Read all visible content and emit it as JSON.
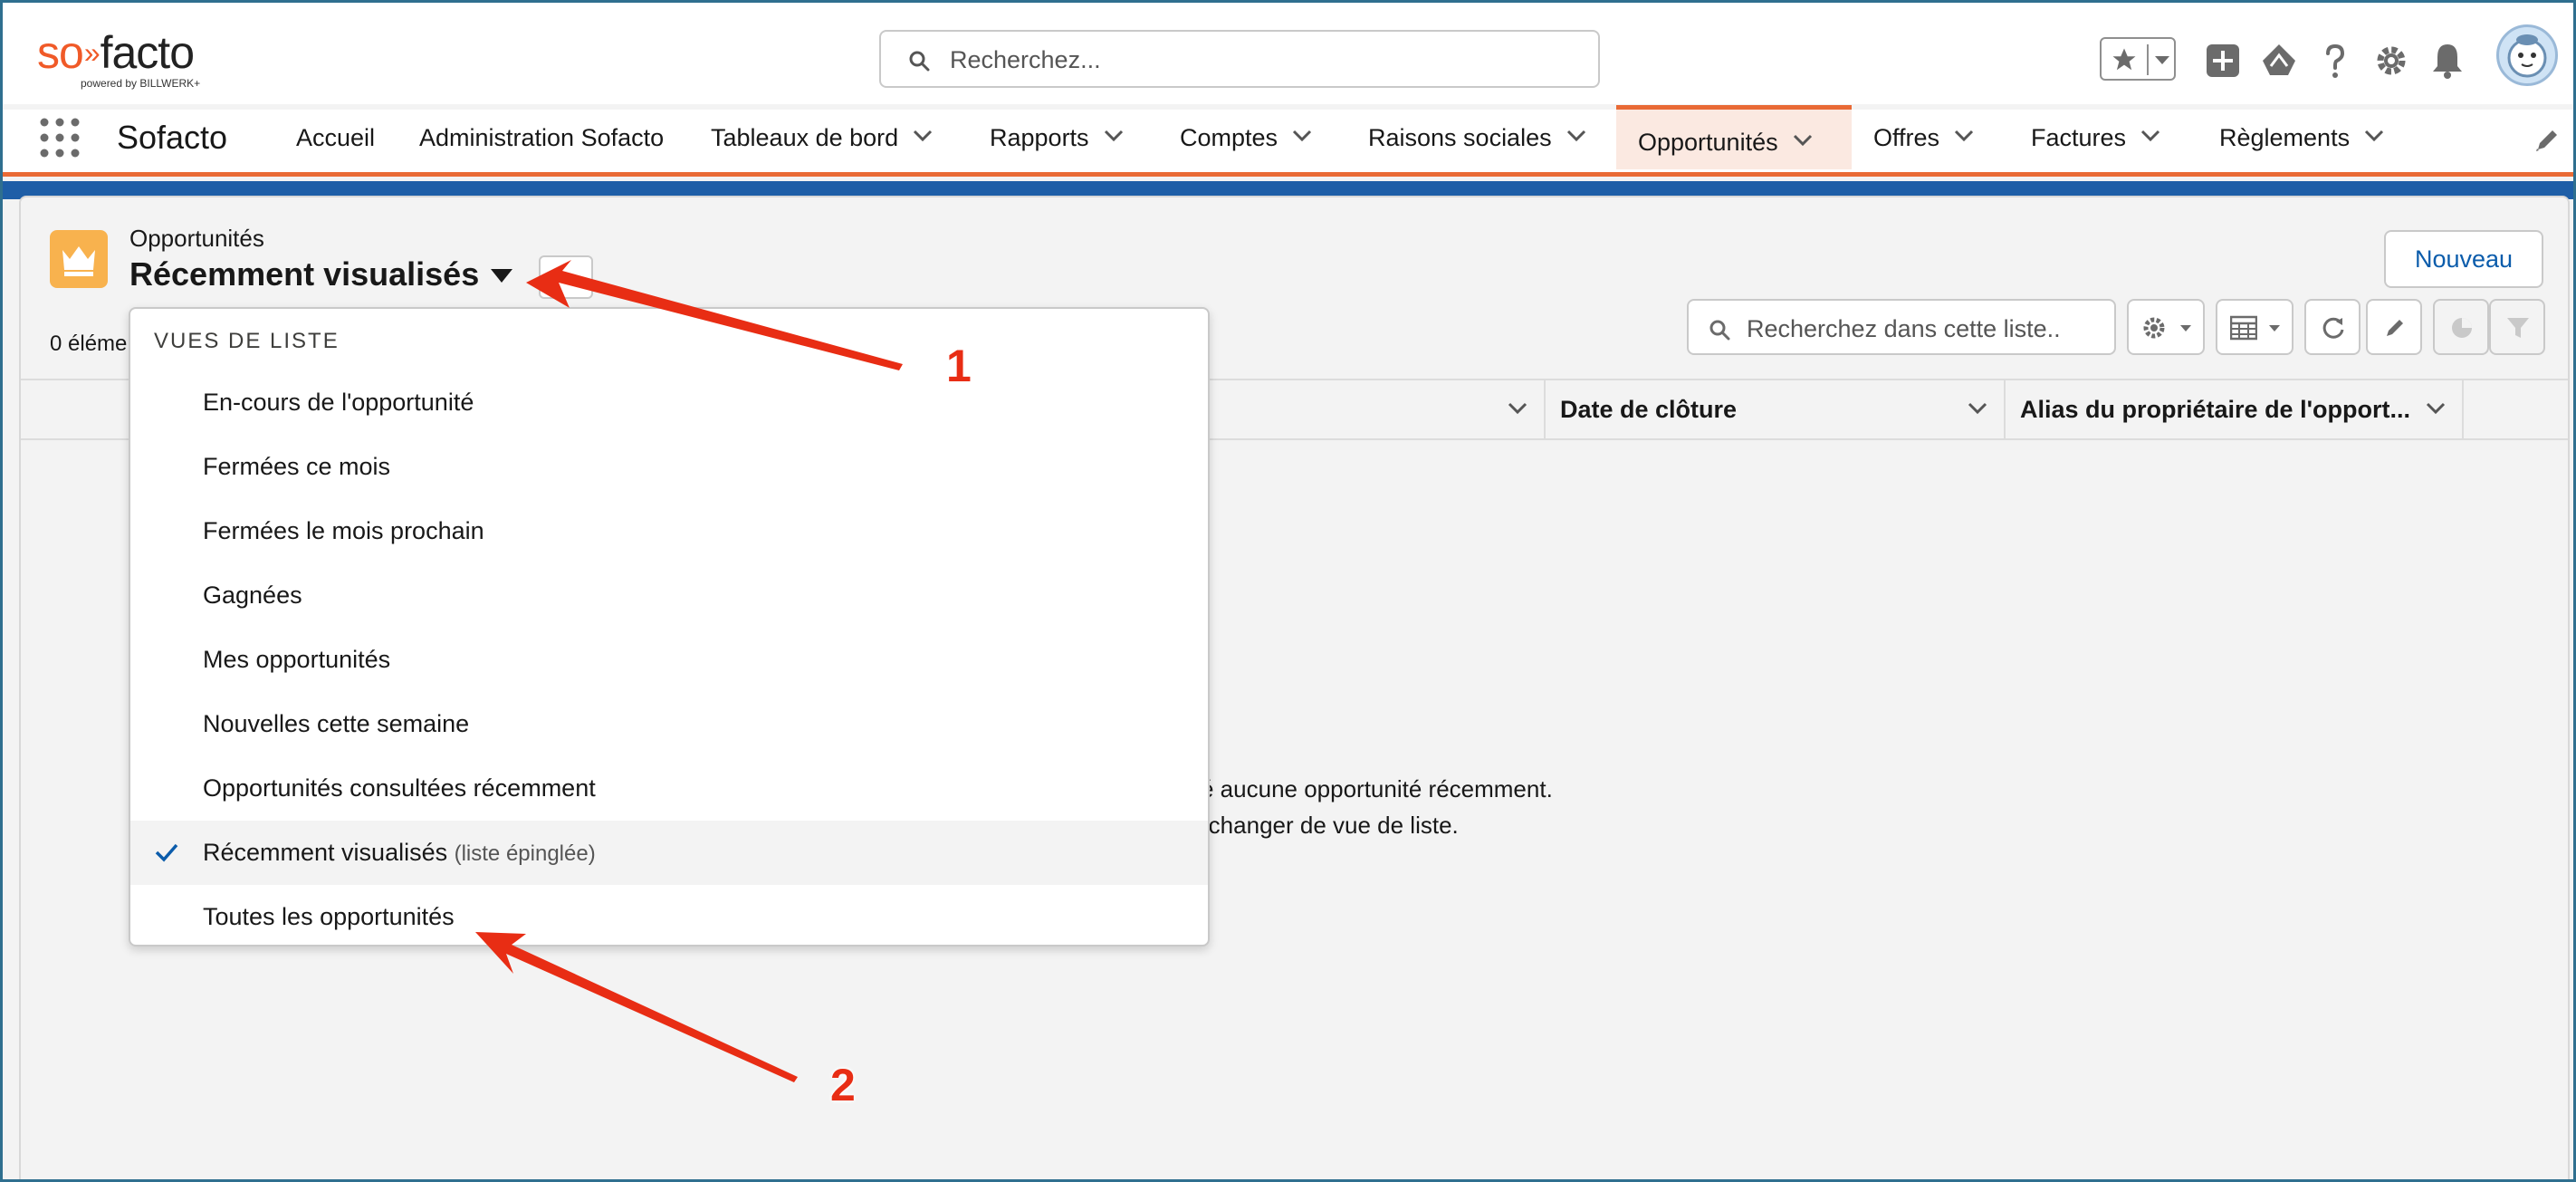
{
  "header": {
    "logo_text": "so»facto",
    "logo_tagline": "powered by BILLWERK+",
    "search_placeholder": "Recherchez..."
  },
  "nav": {
    "app_name": "Sofacto",
    "items": [
      {
        "label": "Accueil"
      },
      {
        "label": "Administration Sofacto"
      },
      {
        "label": "Tableaux de bord"
      },
      {
        "label": "Rapports"
      },
      {
        "label": "Comptes"
      },
      {
        "label": "Raisons sociales"
      },
      {
        "label": "Opportunités"
      },
      {
        "label": "Offres"
      },
      {
        "label": "Factures"
      },
      {
        "label": "Règlements"
      }
    ],
    "active": "Opportunités"
  },
  "list": {
    "object_label": "Opportunités",
    "view_title": "Récemment visualisés",
    "count_text": "0 éléme",
    "new_button": "Nouveau",
    "search_placeholder": "Recherchez dans cette liste..",
    "columns": [
      {
        "label": ""
      },
      {
        "label": "Date de clôture"
      },
      {
        "label": "Alias du propriétaire de l'opport..."
      }
    ],
    "empty_line_1": "sé aucune opportunité récemment.",
    "empty_line_2": "e changer de vue de liste."
  },
  "dropdown": {
    "header": "VUES DE LISTE",
    "items": [
      {
        "label": "En-cours de l'opportunité"
      },
      {
        "label": "Fermées ce mois"
      },
      {
        "label": "Fermées le mois prochain"
      },
      {
        "label": "Gagnées"
      },
      {
        "label": "Mes opportunités"
      },
      {
        "label": "Nouvelles cette semaine"
      },
      {
        "label": "Opportunités consultées récemment"
      },
      {
        "label": "Récemment visualisés",
        "suffix": "(liste épinglée)",
        "selected": true
      },
      {
        "label": "Toutes les opportunités"
      }
    ]
  },
  "annotations": {
    "label_1": "1",
    "label_2": "2",
    "color": "#e82d14"
  },
  "colors": {
    "accent": "#e96a35",
    "brand_blue": "#1e5ea7",
    "link_blue": "#0b5cab",
    "object_icon": "#f8b24e"
  }
}
